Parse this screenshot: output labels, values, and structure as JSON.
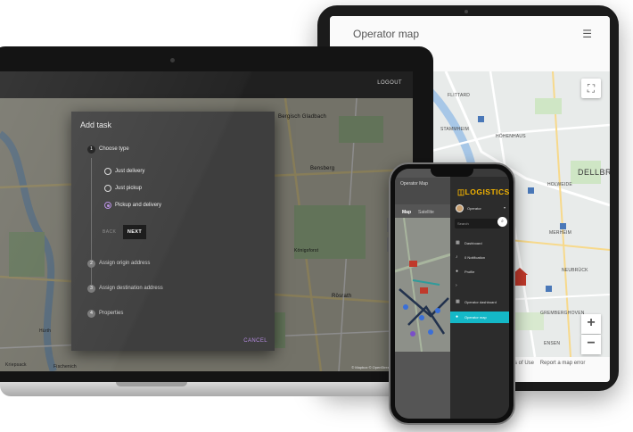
{
  "tablet": {
    "title": "Operator map",
    "menu_icon": "hamburger-icon",
    "fullscreen_icon": "fullscreen-icon",
    "zoom_in": "+",
    "zoom_out": "−",
    "footer_terms": "rms of Use",
    "footer_report": "Report a map error",
    "map_labels": [
      "FLITTARD",
      "STAMMHEIM",
      "HÖHENHAUS",
      "DELLBRU",
      "HOLWEIDE",
      "MERHEIM",
      "NEUBRÜCK",
      "GREMBERGHOVEN",
      "ENSEN"
    ]
  },
  "laptop": {
    "logout_label": "LOGOUT",
    "attribution": "© Mapbox © OpenStreetMap  Impr",
    "map_labels": [
      "Bergisch Gladbach",
      "Bensberg",
      "Rösrath",
      "Hürth",
      "Kriepsack",
      "Fischenich",
      "Königsforst"
    ],
    "dialog": {
      "title": "Add task",
      "steps": [
        {
          "num": "1",
          "label": "Choose type"
        },
        {
          "num": "2",
          "label": "Assign origin address"
        },
        {
          "num": "3",
          "label": "Assign destination address"
        },
        {
          "num": "4",
          "label": "Properties"
        }
      ],
      "options": [
        "Just delivery",
        "Just pickup",
        "Pickup and delivery"
      ],
      "selected_option": "Pickup and delivery",
      "back_label": "BACK",
      "next_label": "NEXT",
      "cancel_label": "CANCEL"
    }
  },
  "phone": {
    "title": "Operator Map",
    "tabs": [
      "Map",
      "Satellite"
    ],
    "logo": "LOGISTICS",
    "user": "Operator",
    "search_placeholder": "Search",
    "nav": [
      {
        "icon": "dashboard-icon",
        "glyph": "▦",
        "label": "Dashboard"
      },
      {
        "icon": "bell-icon",
        "glyph": "♪",
        "label": "0  Notification"
      },
      {
        "icon": "person-icon",
        "glyph": "●",
        "label": "Profile"
      },
      {
        "icon": "chevron-right-icon",
        "glyph": "›",
        "label": ""
      },
      {
        "icon": "dashboard-icon",
        "glyph": "▦",
        "label": "Operator dashboard"
      },
      {
        "icon": "location-pin-icon",
        "glyph": "●",
        "label": "Operator map"
      }
    ]
  },
  "colors": {
    "accent_purple": "#b48be0",
    "nav_active": "#14b8c7",
    "logo_yellow": "#f4b400"
  }
}
